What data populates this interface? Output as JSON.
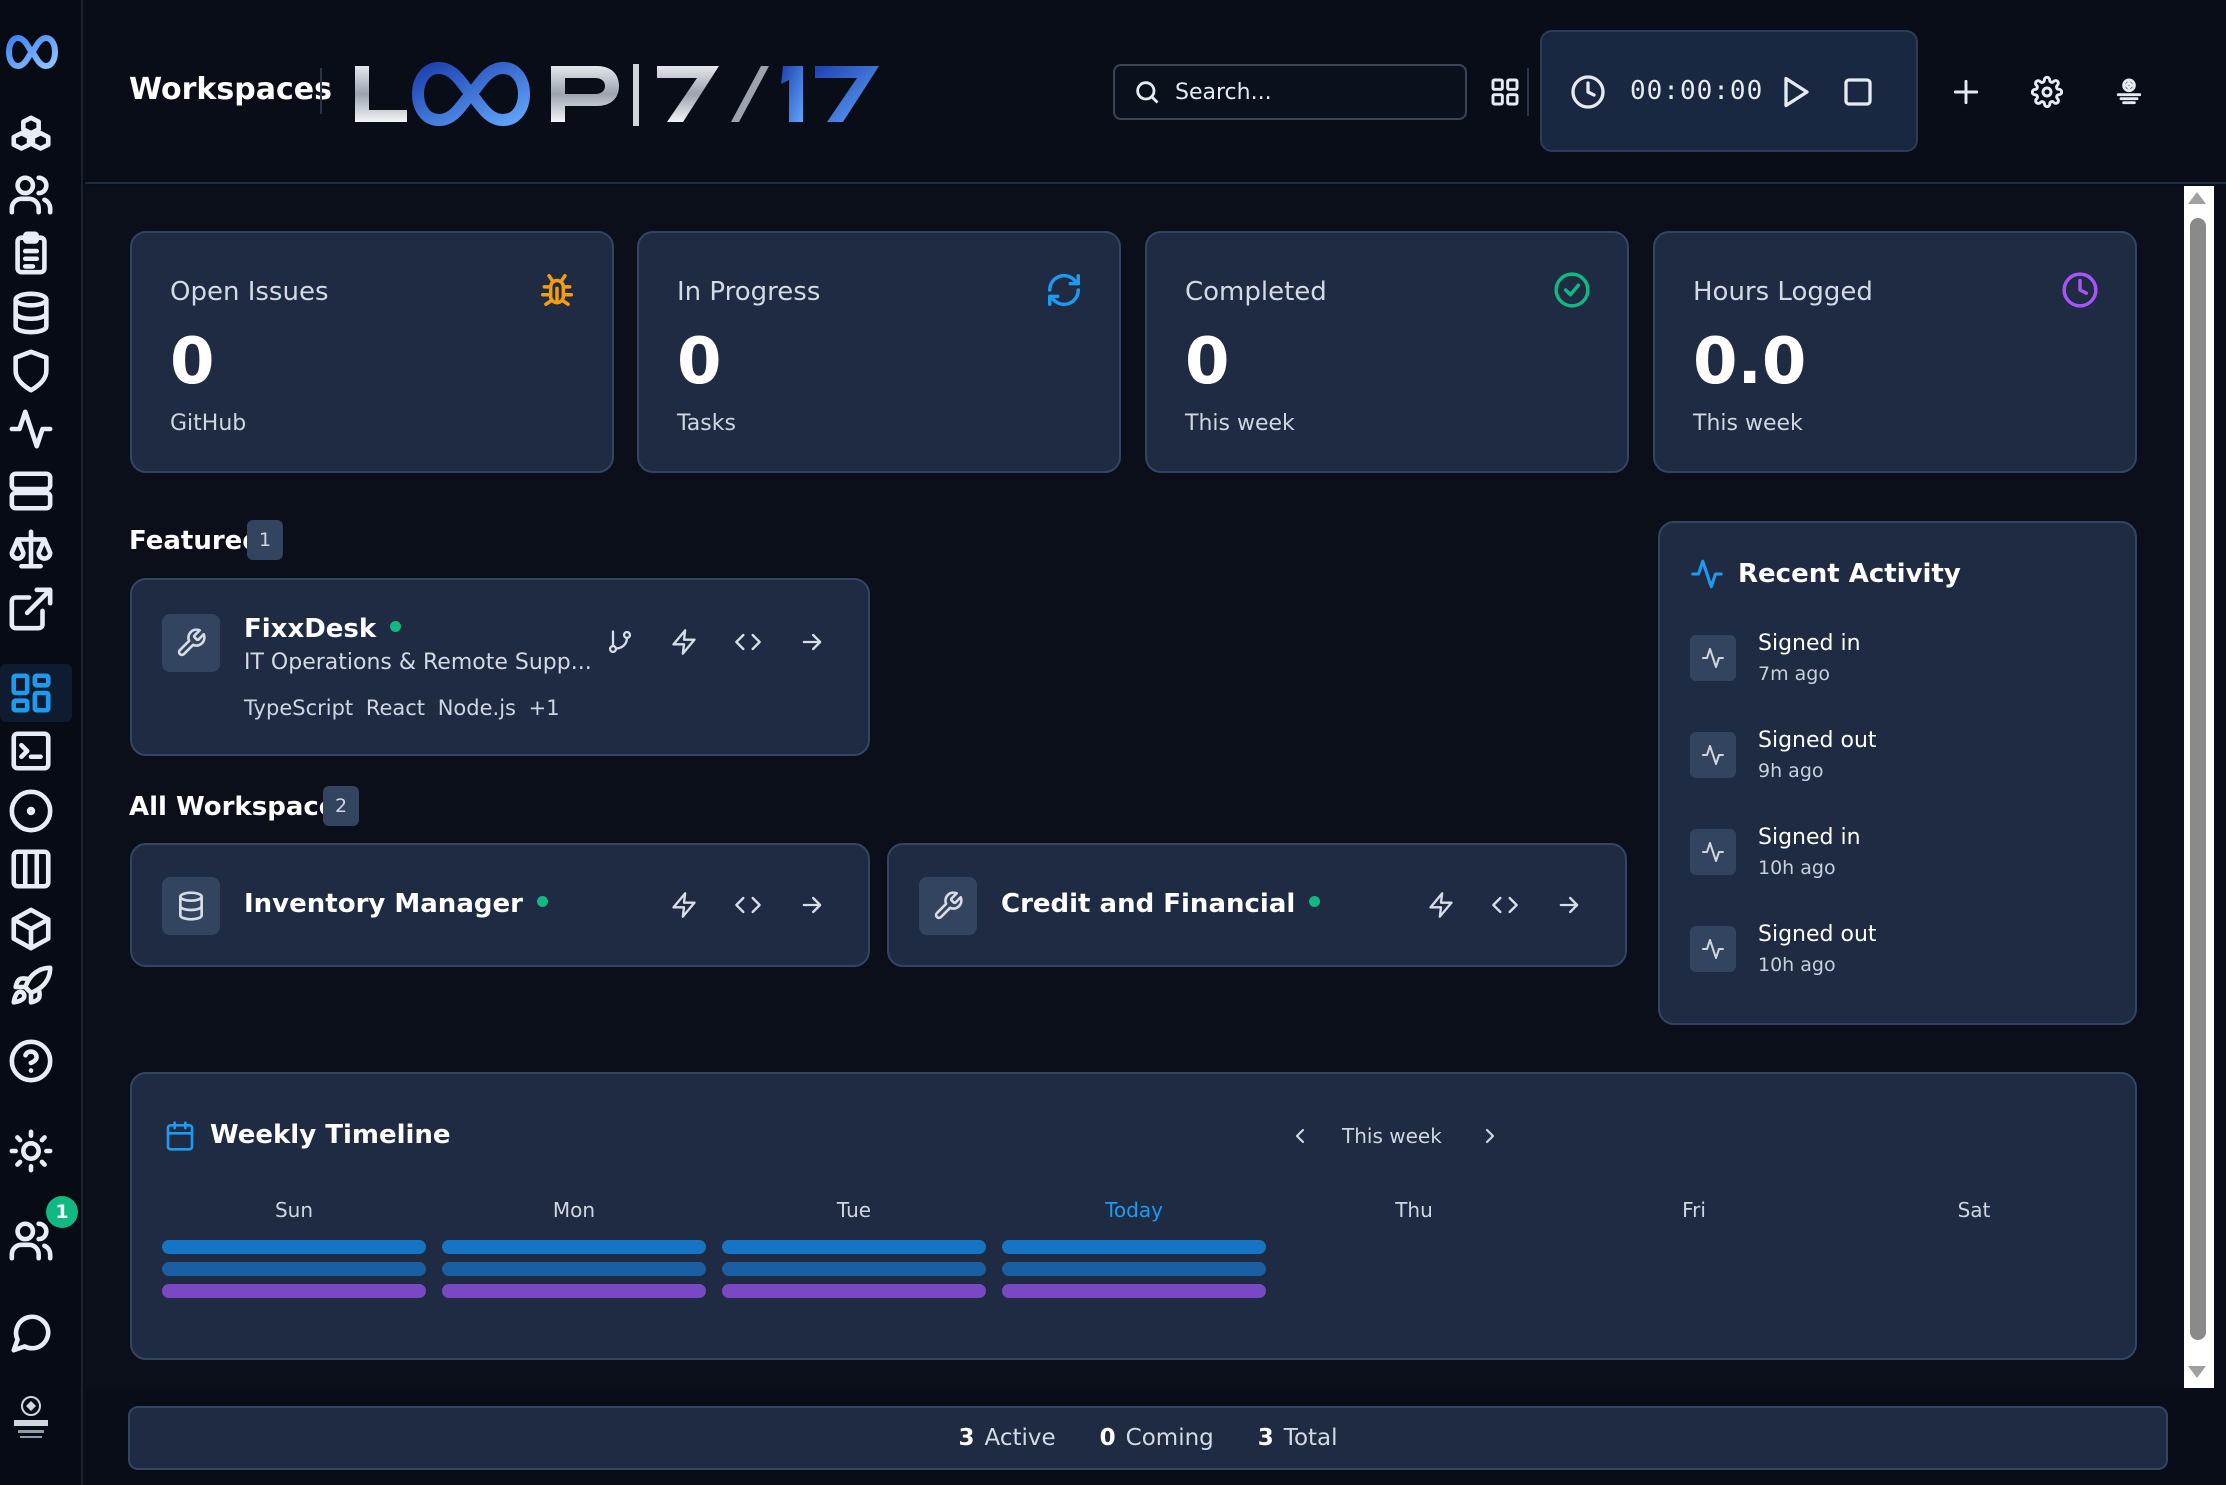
{
  "header": {
    "title": "Workspaces",
    "search_placeholder": "Search...",
    "timer": "00:00:00"
  },
  "stats": [
    {
      "label": "Open Issues",
      "value": "0",
      "sub": "GitHub",
      "icon": "bug-icon",
      "color": "#f59e0b"
    },
    {
      "label": "In Progress",
      "value": "0",
      "sub": "Tasks",
      "icon": "refresh-icon",
      "color": "#1d9bf0"
    },
    {
      "label": "Completed",
      "value": "0",
      "sub": "This week",
      "icon": "check-circle-icon",
      "color": "#10b981"
    },
    {
      "label": "Hours Logged",
      "value": "0.0",
      "sub": "This week",
      "icon": "clock-icon",
      "color": "#a855f7"
    }
  ],
  "featured": {
    "title": "Featured",
    "count": "1",
    "items": [
      {
        "name": "FixxDesk",
        "desc": "IT Operations & Remote Supp...",
        "tags": "TypeScript React Node.js +1",
        "status_color": "#10b981"
      }
    ]
  },
  "all_workspaces": {
    "title": "All Workspaces",
    "count": "2",
    "items": [
      {
        "name": "Inventory Manager",
        "icon": "database-icon"
      },
      {
        "name": "Credit and Financial",
        "icon": "wrench-icon"
      }
    ]
  },
  "recent_activity": {
    "title": "Recent Activity",
    "items": [
      {
        "text": "Signed in",
        "time": "7m ago"
      },
      {
        "text": "Signed out",
        "time": "9h ago"
      },
      {
        "text": "Signed in",
        "time": "10h ago"
      },
      {
        "text": "Signed out",
        "time": "10h ago"
      }
    ]
  },
  "weekly_timeline": {
    "title": "Weekly Timeline",
    "range": "This week",
    "days": [
      "Sun",
      "Mon",
      "Tue",
      "Today",
      "Thu",
      "Fri",
      "Sat"
    ],
    "today_index": 3,
    "bar_colors": [
      "#1574c4",
      "#1a5fa3",
      "#7a48c2"
    ],
    "days_with_activity": 4
  },
  "footer": {
    "active_count": "3",
    "active_label": "Active",
    "coming_count": "0",
    "coming_label": "Coming",
    "total_count": "3",
    "total_label": "Total"
  },
  "sidebar": {
    "badge": "1"
  }
}
